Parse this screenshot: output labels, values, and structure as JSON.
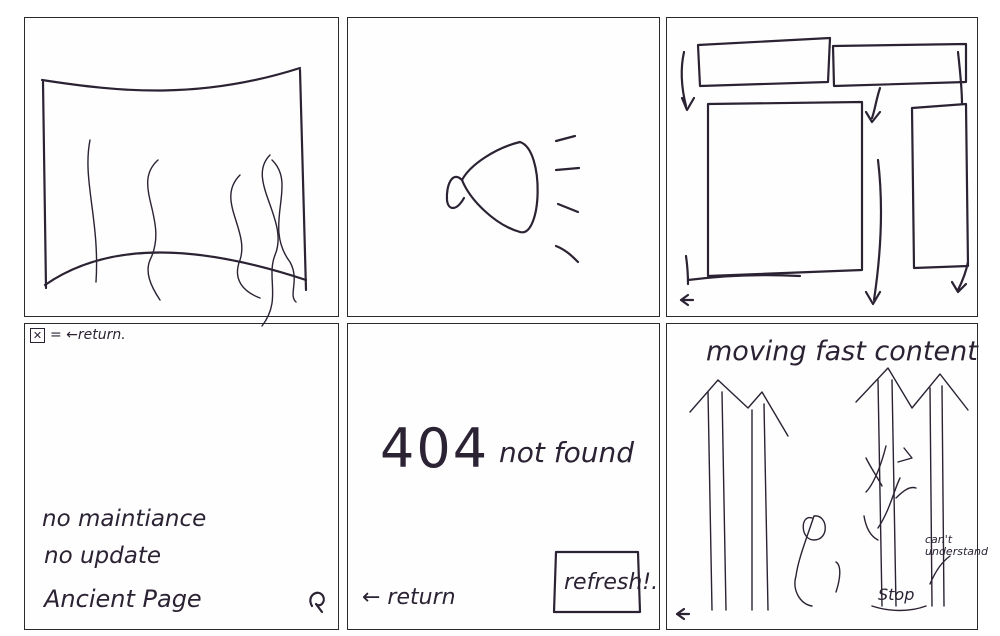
{
  "panel4": {
    "legend": "= ←return.",
    "lines": [
      "no maintiance",
      "no update",
      "Ancient Page"
    ]
  },
  "panel5": {
    "error_code": "404",
    "error_text": "not found",
    "return_label": "← return",
    "refresh_label": "refresh!."
  },
  "panel6": {
    "title": "moving fast content",
    "note": "can't understand",
    "stop_label": "Stop"
  },
  "colors": {
    "ink": "#2b2233",
    "paper": "#ffffff",
    "border": "#2a2a2a"
  }
}
